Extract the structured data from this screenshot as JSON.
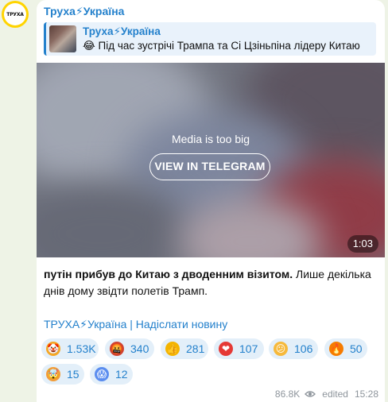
{
  "avatar": {
    "text": "ТРУХА"
  },
  "post": {
    "channel_name": "Труха⚡Україна",
    "reply": {
      "name": "Труха⚡Україна",
      "text": "😂 Під час зустрічі Трампа та Сі Цзіньпіна лідеру Китаю"
    },
    "media": {
      "message": "Media is too big",
      "button_label": "VIEW IN TELEGRAM",
      "duration": "1:03"
    },
    "text_bold": "путін прибув до Китаю з дводенним візитом.",
    "text_rest": " Лише декілька днів дому звідти полетів Трамп.",
    "signature": "ТРУХА⚡Україна | Надіслати новину"
  },
  "reactions": [
    {
      "icon": "clown-face-icon",
      "glyph": "🤡",
      "color": "#f5a623",
      "count": "1.53K"
    },
    {
      "icon": "angry-face-icon",
      "glyph": "🤬",
      "color": "#d0432f",
      "count": "340"
    },
    {
      "icon": "thumbs-up-icon",
      "glyph": "👍",
      "color": "#f4b400",
      "count": "281"
    },
    {
      "icon": "red-heart-icon",
      "glyph": "❤",
      "color": "#e53935",
      "count": "107"
    },
    {
      "icon": "confused-face-icon",
      "glyph": "😕",
      "color": "#f6b93b",
      "count": "106"
    },
    {
      "icon": "fire-icon",
      "glyph": "🔥",
      "color": "#f57c00",
      "count": "50"
    },
    {
      "icon": "exploding-head-icon",
      "glyph": "🤯",
      "color": "#f29d38",
      "count": "15"
    },
    {
      "icon": "screaming-face-icon",
      "glyph": "😱",
      "color": "#5b8def",
      "count": "12"
    }
  ],
  "footer": {
    "views": "86.8K",
    "edited": "edited",
    "time": "15:28"
  },
  "colors": {
    "accent": "#2481cc",
    "background": "#eef3e6",
    "bubble": "#ffffff",
    "reaction_bg": "#e3eff9"
  }
}
